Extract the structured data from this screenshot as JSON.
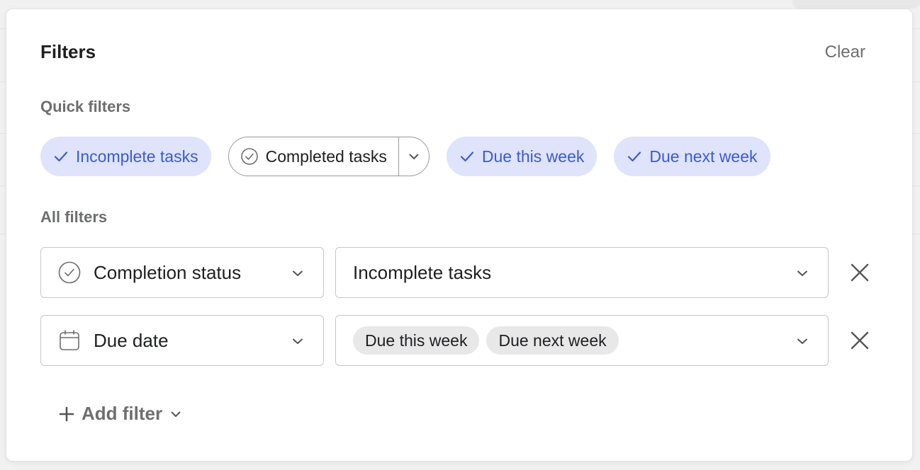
{
  "panel": {
    "title": "Filters",
    "clear_label": "Clear"
  },
  "quick_filters": {
    "label": "Quick filters",
    "chips": [
      {
        "label": "Incomplete tasks",
        "active": true
      },
      {
        "label": "Completed tasks",
        "active": false
      },
      {
        "label": "Due this week",
        "active": true
      },
      {
        "label": "Due next week",
        "active": true
      }
    ]
  },
  "all_filters": {
    "label": "All filters",
    "rows": [
      {
        "field": "Completion status",
        "field_icon": "check-circle-icon",
        "value": "Incomplete tasks"
      },
      {
        "field": "Due date",
        "field_icon": "calendar-icon",
        "value_tags": [
          "Due this week",
          "Due next week"
        ]
      }
    ]
  },
  "add_filter": {
    "label": "Add filter"
  },
  "colors": {
    "accent": "#3b5ccc",
    "chip_active_bg": "#dfe3fb",
    "muted_text": "#6d6e6f",
    "border": "#c7c7c8"
  }
}
